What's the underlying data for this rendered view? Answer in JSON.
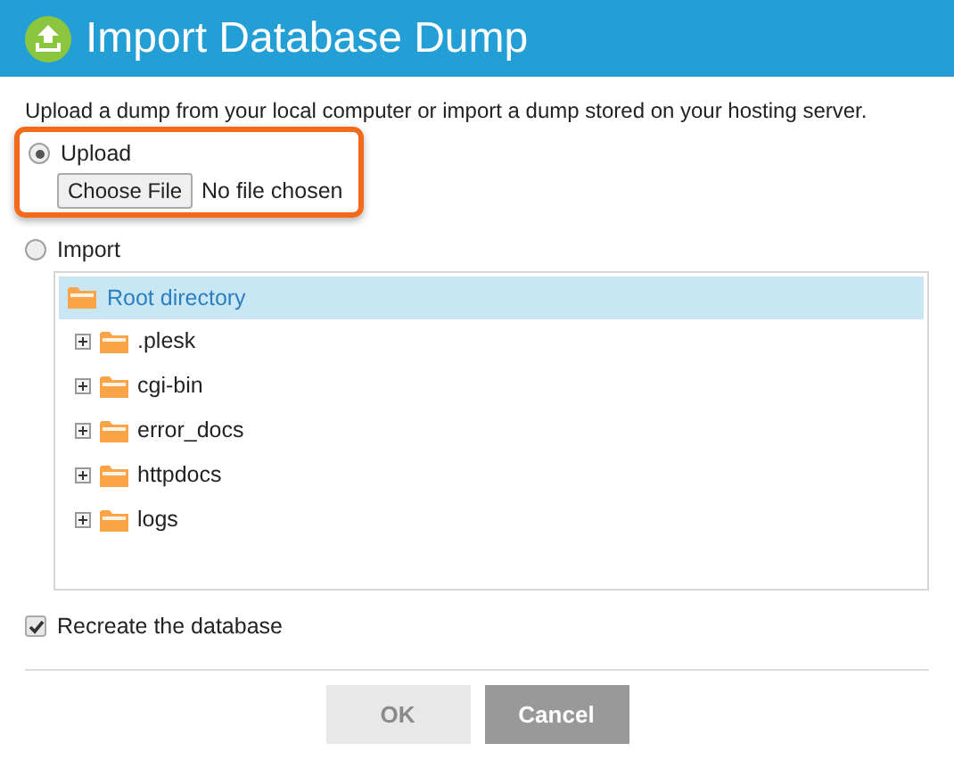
{
  "dialog": {
    "title": "Import Database Dump"
  },
  "description": "Upload a dump from your local computer or import a dump stored on your hosting server.",
  "sources": [
    {
      "kind": "upload",
      "label": "Upload",
      "selected": true,
      "highlighted": true,
      "file_button": "Choose File",
      "file_status": "No file chosen"
    },
    {
      "kind": "import",
      "label": "Import",
      "selected": false,
      "highlighted": false,
      "tree": {
        "root": {
          "label": "Root directory",
          "selected": true
        },
        "items": [
          {
            "label": ".plesk",
            "expanded": false
          },
          {
            "label": "cgi-bin",
            "expanded": false
          },
          {
            "label": "error_docs",
            "expanded": false
          },
          {
            "label": "httpdocs",
            "expanded": false
          },
          {
            "label": "logs",
            "expanded": false
          }
        ]
      }
    }
  ],
  "recreate": {
    "label": "Recreate the database",
    "checked": true
  },
  "buttons": [
    {
      "label": "OK",
      "disabled": true
    },
    {
      "label": "Cancel",
      "disabled": false
    }
  ]
}
